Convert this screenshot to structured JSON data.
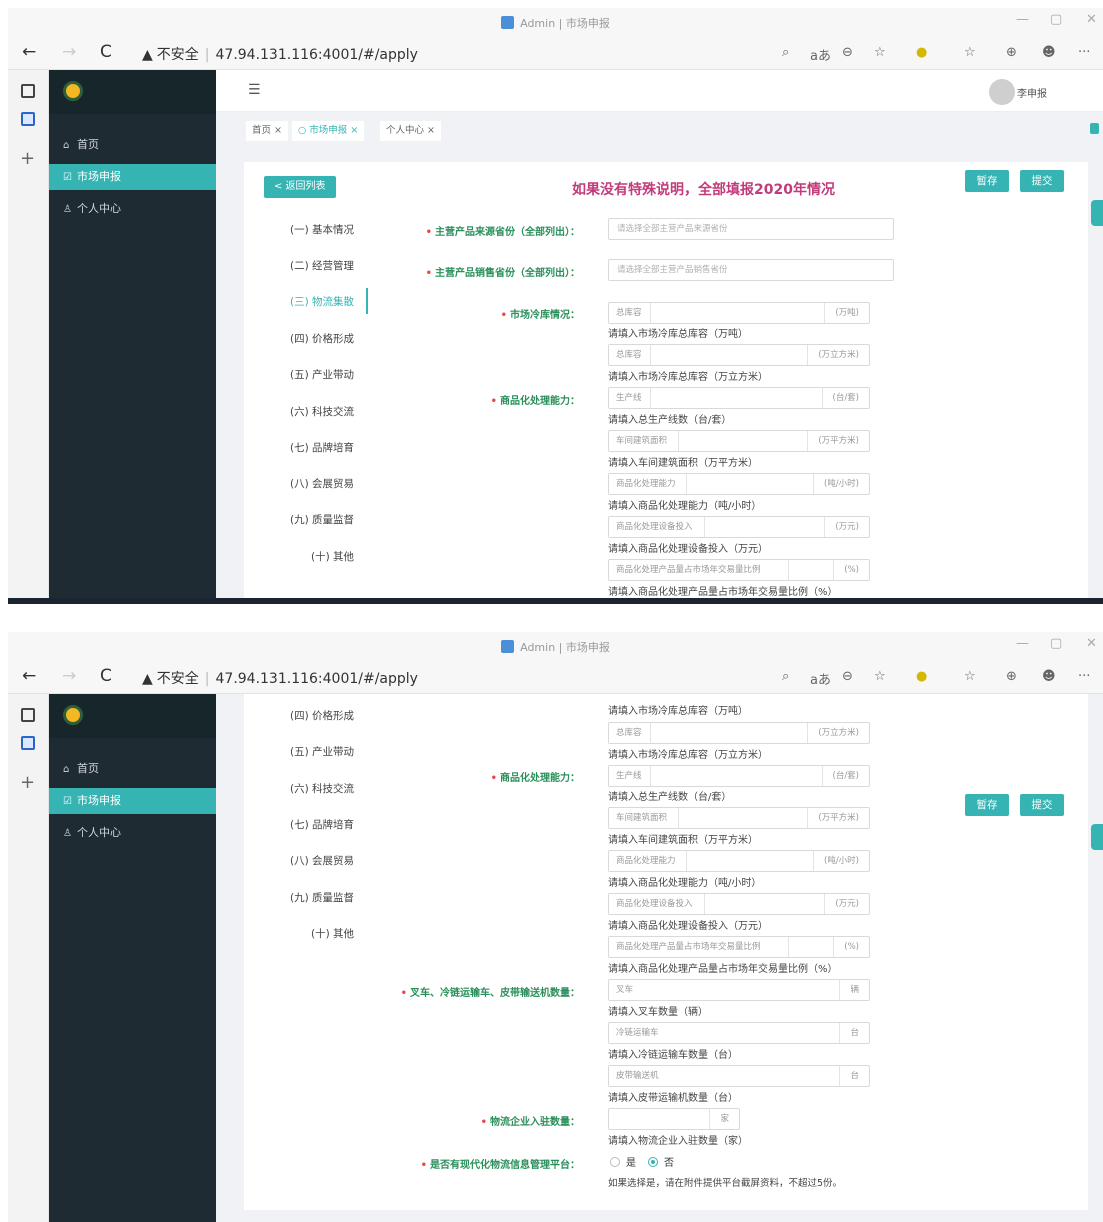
{
  "browser": {
    "window_title": "Admin | 市场申报",
    "security": "不安全",
    "url": "47.94.131.116:4001/#/apply",
    "back": "←",
    "forward": "→",
    "reload": "C",
    "tools": [
      "⌕",
      "aあ",
      "⊖",
      "☆",
      "●",
      "☆",
      "≡",
      "⊕",
      "☻",
      "···"
    ]
  },
  "sidebar": {
    "items": [
      {
        "icon": "⌂",
        "label": "首页"
      },
      {
        "icon": "☑",
        "label": "市场申报"
      },
      {
        "icon": "♙",
        "label": "个人中心"
      }
    ]
  },
  "header": {
    "menu": "☰",
    "username": "李申报"
  },
  "tabs": [
    {
      "label": "首页 ×"
    },
    {
      "label": "○ 市场申报 ×"
    },
    {
      "label": "个人中心 ×"
    }
  ],
  "page": {
    "back_button": "< 返回列表",
    "heading": "如果没有特殊说明，全部填报2020年情况",
    "save_button": "暂存",
    "submit_button": "提交"
  },
  "sections": [
    "(一) 基本情况",
    "(二) 经营管理",
    "(三) 物流集散",
    "(四) 价格形成",
    "(五) 产业带动",
    "(六) 科技交流",
    "(七) 品牌培育",
    "(八) 会展贸易",
    "(九) 质量监督",
    "(十) 其他"
  ],
  "form": {
    "source_label": "主营产品来源省份（全部列出）：",
    "source_placeholder": "请选择全部主营产品来源省份",
    "sales_label": "主营产品销售省份（全部列出）：",
    "sales_placeholder": "请选择全部主营产品销售省份",
    "cold_label": "市场冷库情况：",
    "cold": [
      {
        "prefix": "总库容",
        "suffix": "(万吨)",
        "hint": "请填入市场冷库总库容（万吨）"
      },
      {
        "prefix": "总库容",
        "suffix": "(万立方米)",
        "hint": "请填入市场冷库总库容（万立方米）"
      }
    ],
    "commer_label": "商品化处理能力：",
    "commer": [
      {
        "prefix": "生产线",
        "suffix": "(台/套)",
        "hint": "请填入总生产线数（台/套）"
      },
      {
        "prefix": "车间建筑面积",
        "suffix": "(万平方米)",
        "hint": "请填入车间建筑面积（万平方米）"
      },
      {
        "prefix": "商品化处理能力",
        "suffix": "(吨/小时)",
        "hint": "请填入商品化处理能力（吨/小时）"
      },
      {
        "prefix": "商品化处理设备投入",
        "suffix": "(万元)",
        "hint": "请填入商品化处理设备投入（万元）"
      },
      {
        "prefix": "商品化处理产品量占市场年交易量比例",
        "suffix": "(%)",
        "hint": "请填入商品化处理产品量占市场年交易量比例（%）"
      }
    ],
    "vehicle_label": "叉车、冷链运输车、皮带输送机数量：",
    "vehicles": [
      {
        "prefix": "叉车",
        "suffix": "辆",
        "hint": "请填入叉车数量（辆）"
      },
      {
        "prefix": "冷链运输车",
        "suffix": "台",
        "hint": "请填入冷链运输车数量（台）"
      },
      {
        "prefix": "皮带输送机",
        "suffix": "台",
        "hint": "请填入皮带运输机数量（台）"
      }
    ],
    "logistics_label": "物流企业入驻数量：",
    "logistics_suffix": "家",
    "logistics_hint": "请填入物流企业入驻数量（家）",
    "platform_label": "是否有现代化物流信息管理平台：",
    "platform_yes": "是",
    "platform_no": "否",
    "platform_selected": "否",
    "platform_hint": "如果选择是，请在附件提供平台截屏资料，不超过5份。"
  },
  "colors": {
    "accent": "#36b4b3",
    "sidebar": "#1e2b33",
    "heading": "#c23b7a",
    "label": "#2a8f5a",
    "required": "#e5484d"
  }
}
